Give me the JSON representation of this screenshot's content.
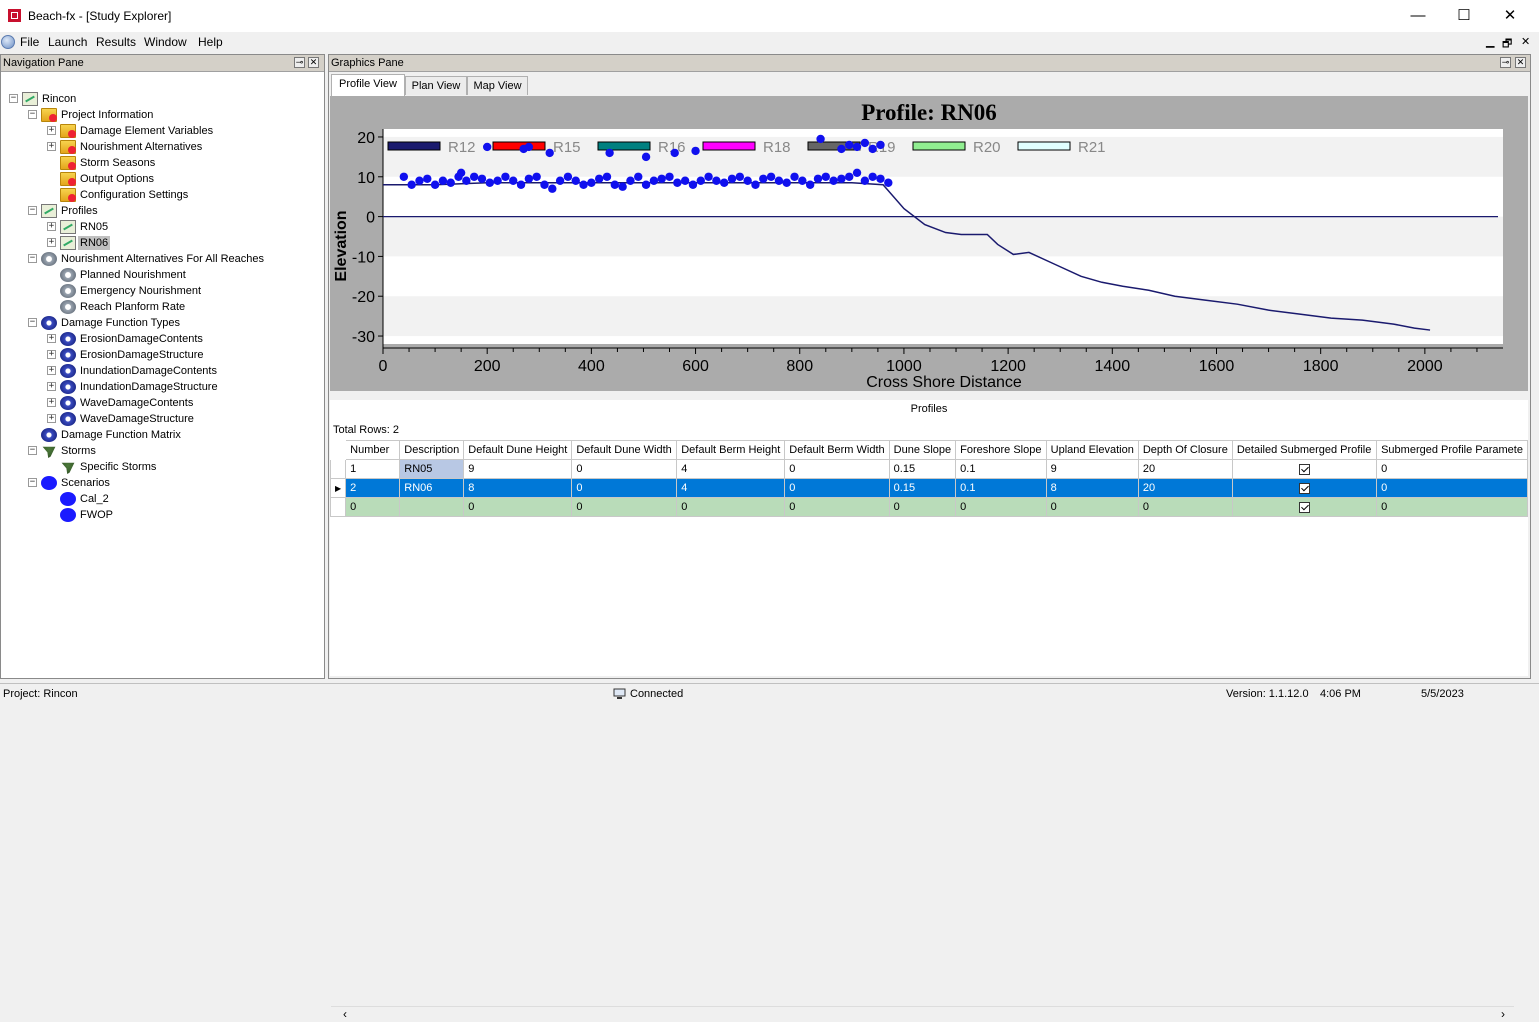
{
  "window": {
    "title": "Beach-fx - [Study Explorer]",
    "minimize": "—",
    "maximize": "☐",
    "close": "✕"
  },
  "menu": {
    "items": [
      "File",
      "Launch",
      "Results",
      "Window",
      "Help"
    ],
    "mdi_min": "▁",
    "mdi_restore": "🗗",
    "mdi_close": "✕"
  },
  "nav": {
    "header": "Navigation Pane",
    "tree": [
      {
        "label": "Rincon",
        "level": 0,
        "icon": "project-icon",
        "exp": "−"
      },
      {
        "label": "Project Information",
        "level": 1,
        "icon": "folder-icon",
        "exp": "−"
      },
      {
        "label": "Damage Element Variables",
        "level": 2,
        "icon": "folder-icon",
        "exp": "+"
      },
      {
        "label": "Nourishment Alternatives",
        "level": 2,
        "icon": "folder-icon",
        "exp": "+"
      },
      {
        "label": "Storm Seasons",
        "level": 2,
        "icon": "folder-icon",
        "exp": ""
      },
      {
        "label": "Output Options",
        "level": 2,
        "icon": "folder-icon",
        "exp": ""
      },
      {
        "label": "Configuration Settings",
        "level": 2,
        "icon": "folder-icon",
        "exp": ""
      },
      {
        "label": "Profiles",
        "level": 1,
        "icon": "profile-icon",
        "exp": "−"
      },
      {
        "label": "RN05",
        "level": 2,
        "icon": "profile-icon",
        "exp": "+"
      },
      {
        "label": "RN06",
        "level": 2,
        "icon": "profile-icon",
        "exp": "+",
        "selected": true
      },
      {
        "label": "Nourishment Alternatives For All Reaches",
        "level": 1,
        "icon": "gear-icon",
        "exp": "−"
      },
      {
        "label": "Planned Nourishment",
        "level": 2,
        "icon": "gear-icon",
        "exp": ""
      },
      {
        "label": "Emergency Nourishment",
        "level": 2,
        "icon": "gear-icon",
        "exp": ""
      },
      {
        "label": "Reach Planform Rate",
        "level": 2,
        "icon": "gear-icon",
        "exp": ""
      },
      {
        "label": "Damage Function Types",
        "level": 1,
        "icon": "gearblue-icon",
        "exp": "−"
      },
      {
        "label": "ErosionDamageContents",
        "level": 2,
        "icon": "gearblue-icon",
        "exp": "+"
      },
      {
        "label": "ErosionDamageStructure",
        "level": 2,
        "icon": "gearblue-icon",
        "exp": "+"
      },
      {
        "label": "InundationDamageContents",
        "level": 2,
        "icon": "gearblue-icon",
        "exp": "+"
      },
      {
        "label": "InundationDamageStructure",
        "level": 2,
        "icon": "gearblue-icon",
        "exp": "+"
      },
      {
        "label": "WaveDamageContents",
        "level": 2,
        "icon": "gearblue-icon",
        "exp": "+"
      },
      {
        "label": "WaveDamageStructure",
        "level": 2,
        "icon": "gearblue-icon",
        "exp": "+"
      },
      {
        "label": "Damage Function Matrix",
        "level": 1,
        "icon": "gearblue-icon",
        "exp": ""
      },
      {
        "label": "Storms",
        "level": 1,
        "icon": "storm-icon",
        "exp": "−"
      },
      {
        "label": "Specific Storms",
        "level": 2,
        "icon": "storm-icon",
        "exp": ""
      },
      {
        "label": "Scenarios",
        "level": 1,
        "icon": "scenario-icon",
        "exp": "−"
      },
      {
        "label": "Cal_2",
        "level": 2,
        "icon": "scenario-icon",
        "exp": ""
      },
      {
        "label": "FWOP",
        "level": 2,
        "icon": "scenario-icon",
        "exp": ""
      }
    ]
  },
  "graphics": {
    "header": "Graphics Pane",
    "tabs": [
      "Profile View",
      "Plan View",
      "Map View"
    ],
    "active_tab": "Profile View"
  },
  "chart_data": {
    "type": "line",
    "title": "Profile: RN06",
    "xlabel": "Cross Shore Distance",
    "ylabel": "Elevation",
    "xlim": [
      0,
      2150
    ],
    "ylim": [
      -32,
      22
    ],
    "xticks": [
      0,
      200,
      400,
      600,
      800,
      1000,
      1200,
      1400,
      1600,
      1800,
      2000
    ],
    "yticks": [
      -30,
      -20,
      -10,
      0,
      10,
      20
    ],
    "legend": [
      {
        "name": "R12",
        "color": "#1a1a6e"
      },
      {
        "name": "R15",
        "color": "#ff0000"
      },
      {
        "name": "R16",
        "color": "#008080"
      },
      {
        "name": "R18",
        "color": "#ff00ff"
      },
      {
        "name": "R19",
        "color": "#666666"
      },
      {
        "name": "R20",
        "color": "#90ee90"
      },
      {
        "name": "R21",
        "color": "#e0ffff"
      }
    ],
    "legend_placement": "top",
    "profile_line": {
      "name": "R12",
      "color": "#1a1a6e",
      "x": [
        0,
        100,
        200,
        300,
        400,
        500,
        600,
        700,
        800,
        900,
        960,
        1000,
        1040,
        1080,
        1110,
        1160,
        1180,
        1210,
        1240,
        1290,
        1340,
        1380,
        1420,
        1470,
        1520,
        1580,
        1640,
        1700,
        1760,
        1820,
        1880,
        1940,
        1980,
        2010
      ],
      "y": [
        8,
        8,
        8.5,
        8.5,
        8.5,
        8.5,
        8.5,
        8.5,
        8.5,
        8.5,
        8,
        2,
        -2,
        -4,
        -4.5,
        -4.5,
        -7,
        -9.5,
        -9,
        -12,
        -15,
        -16.5,
        -17.5,
        -18.5,
        -20,
        -21,
        -22,
        -23.5,
        -24.5,
        -25.5,
        -26,
        -27,
        -28,
        -28.5
      ]
    },
    "scatter": {
      "color": "#1010ee",
      "x": [
        40,
        55,
        70,
        85,
        100,
        115,
        130,
        145,
        150,
        160,
        175,
        190,
        205,
        220,
        235,
        250,
        265,
        280,
        295,
        310,
        325,
        340,
        355,
        370,
        385,
        400,
        415,
        430,
        445,
        460,
        475,
        490,
        505,
        520,
        535,
        550,
        565,
        580,
        595,
        610,
        625,
        640,
        655,
        670,
        685,
        700,
        715,
        730,
        745,
        760,
        775,
        790,
        805,
        820,
        835,
        850,
        865,
        880,
        895,
        910,
        925,
        940,
        955,
        970,
        200,
        270,
        280,
        320,
        435,
        505,
        560,
        600,
        840,
        880,
        895,
        910,
        925,
        940,
        955
      ],
      "y": [
        10,
        8,
        9,
        9.5,
        8,
        9,
        8.5,
        10,
        11,
        9,
        10,
        9.5,
        8.5,
        9,
        10,
        9,
        8,
        9.5,
        10,
        8,
        7,
        9,
        10,
        9,
        8,
        8.5,
        9.5,
        10,
        8,
        7.5,
        9,
        10,
        8,
        9,
        9.5,
        10,
        8.5,
        9,
        8,
        9,
        10,
        9,
        8.5,
        9.5,
        10,
        9,
        8,
        9.5,
        10,
        9,
        8.5,
        10,
        9,
        8,
        9.5,
        10,
        9,
        9.5,
        10,
        11,
        9,
        10,
        9.5,
        8.5,
        17.5,
        17,
        17.5,
        16,
        16,
        15,
        16,
        16.5,
        19.5,
        17,
        18,
        17.5,
        18.5,
        17,
        18
      ]
    }
  },
  "grid": {
    "title": "Profiles",
    "total_rows": "Total Rows: 2",
    "columns": [
      "Number",
      "Description",
      "Default Dune Height",
      "Default Dune Width",
      "Default Berm Height",
      "Default Berm Width",
      "Dune Slope",
      "Foreshore Slope",
      "Upland Elevation",
      "Depth Of Closure",
      "Detailed Submerged Profile",
      "Submerged Profile Paramete"
    ],
    "rows": [
      {
        "cells": [
          "1",
          "RN05",
          "9",
          "0",
          "4",
          "0",
          "0.15",
          "0.1",
          "9",
          "20",
          "checked",
          "0"
        ],
        "selected": false,
        "marker": ""
      },
      {
        "cells": [
          "2",
          "RN06",
          "8",
          "0",
          "4",
          "0",
          "0.15",
          "0.1",
          "8",
          "20",
          "checked",
          "0"
        ],
        "selected": true,
        "marker": "▶"
      },
      {
        "cells": [
          "0",
          "",
          "0",
          "0",
          "0",
          "0",
          "0",
          "0",
          "0",
          "0",
          "checked",
          "0"
        ],
        "selected": false,
        "marker": "",
        "newrow": true
      }
    ]
  },
  "status": {
    "project": "Project: Rincon",
    "connection": "Connected",
    "version": "Version: 1.1.12.0",
    "time": "4:06 PM",
    "date": "5/5/2023"
  }
}
